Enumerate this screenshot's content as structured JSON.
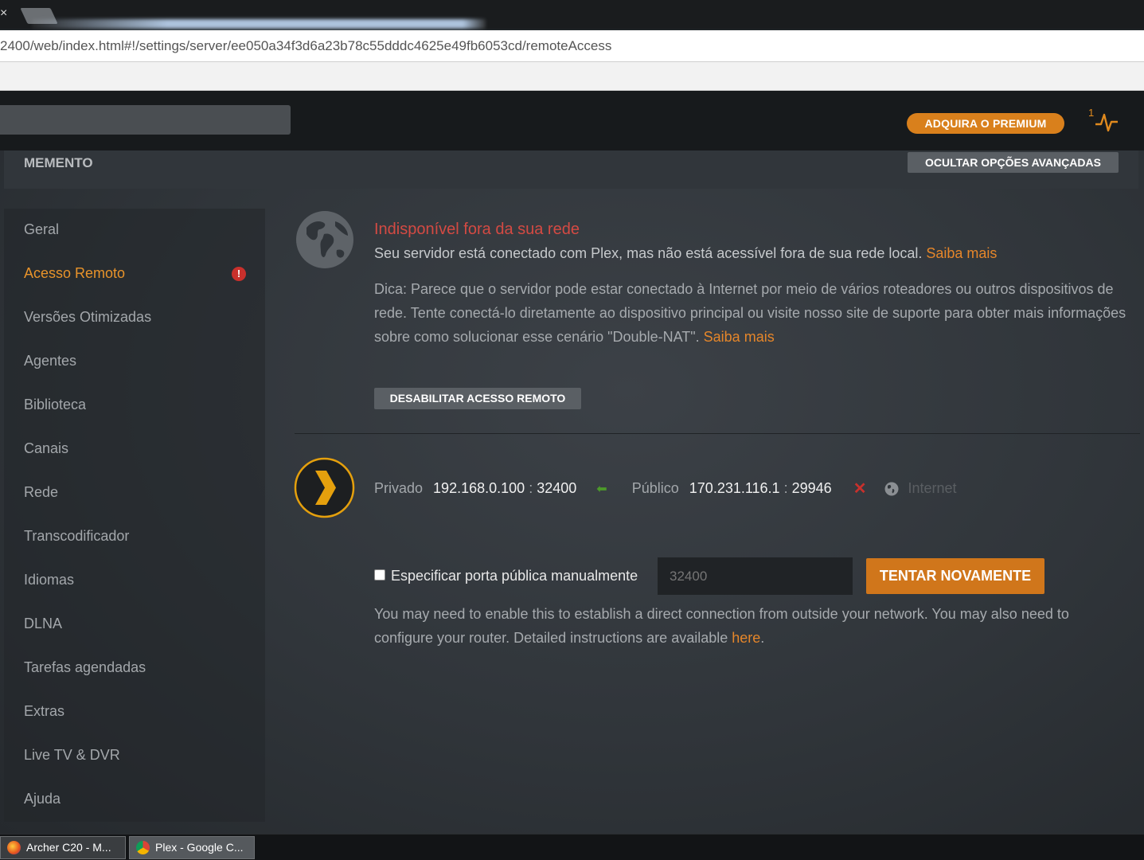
{
  "browser": {
    "tab_close": "×",
    "url": "2400/web/index.html#!/settings/server/ee050a34f3d6a23b78c55dddc4625e49fb6053cd/remoteAccess"
  },
  "header": {
    "premium_label": "ADQUIRA O PREMIUM",
    "activity_count": "1"
  },
  "server_bar": {
    "server_name": "MEMENTO",
    "hide_advanced_label": "OCULTAR OPÇÕES AVANÇADAS"
  },
  "sidebar": {
    "items": [
      {
        "label": "Geral"
      },
      {
        "label": "Acesso Remoto",
        "active": true,
        "alert": "!"
      },
      {
        "label": "Versões Otimizadas"
      },
      {
        "label": "Agentes"
      },
      {
        "label": "Biblioteca"
      },
      {
        "label": "Canais"
      },
      {
        "label": "Rede"
      },
      {
        "label": "Transcodificador"
      },
      {
        "label": "Idiomas"
      },
      {
        "label": "DLNA"
      },
      {
        "label": "Tarefas agendadas"
      },
      {
        "label": "Extras"
      },
      {
        "label": "Live TV & DVR"
      },
      {
        "label": "Ajuda"
      }
    ]
  },
  "status": {
    "title": "Indisponível fora da sua rede",
    "desc": "Seu servidor está conectado com Plex, mas não está acessível fora de sua rede local.",
    "desc_link": "Saiba mais",
    "tip": "Dica: Parece que o servidor pode estar conectado à Internet por meio de vários roteadores ou outros dispositivos de rede. Tente conectá-lo diretamente ao dispositivo principal ou visite nosso site de suporte para obter mais informações sobre como solucionar esse cenário \"Double-NAT\".",
    "tip_link": "Saiba mais",
    "disable_label": "DESABILITAR ACESSO REMOTO"
  },
  "connection": {
    "private_label": "Privado",
    "private_ip": "192.168.0.100",
    "private_port": "32400",
    "port_sep": ":",
    "public_label": "Público",
    "public_ip": "170.231.116.1",
    "public_port": "29946",
    "internet_label": "Internet"
  },
  "manual_port": {
    "checkbox_label": "Especificar porta pública manualmente",
    "placeholder": "32400",
    "retry_label": "TENTAR NOVAMENTE",
    "help": "You may need to enable this to establish a direct connection from outside your network. You may also need to configure your router. Detailed instructions are available",
    "help_link": "here",
    "help_end": "."
  },
  "taskbar": {
    "items": [
      {
        "label": "Archer C20 - M..."
      },
      {
        "label": "Plex - Google C..."
      }
    ]
  },
  "colors": {
    "accent": "#e5862a",
    "error": "#d44a43",
    "ok_green": "#4c9a2a"
  },
  "icons": {
    "globe": "globe-icon",
    "plex": "plex-chevron-icon",
    "activity": "activity-pulse-icon",
    "arrow_left": "arrow-left-icon",
    "x": "x-icon",
    "internet": "internet-globe-icon"
  }
}
